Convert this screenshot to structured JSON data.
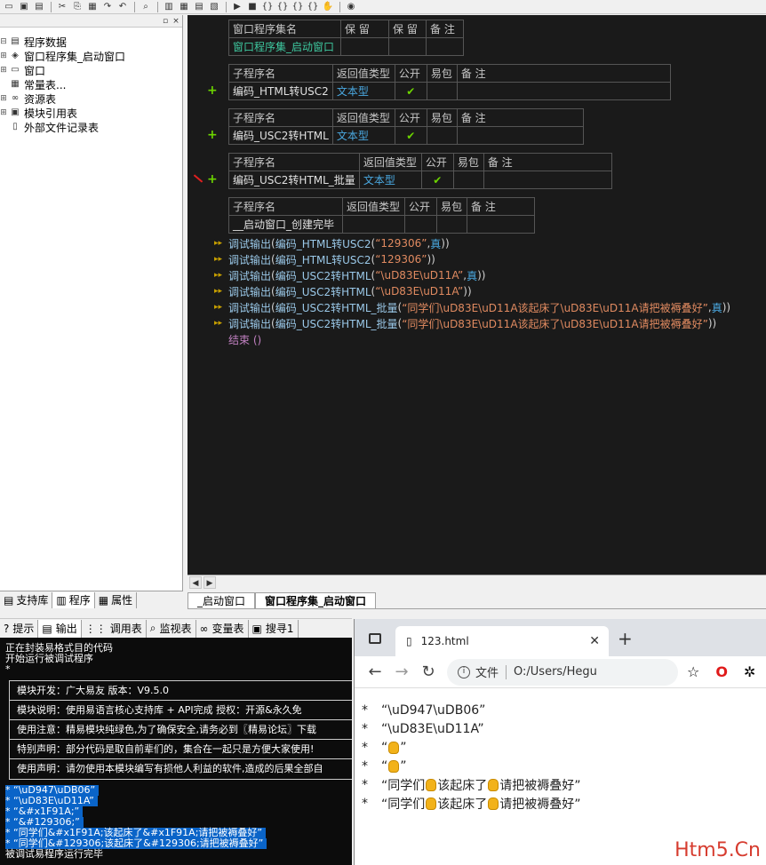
{
  "tree": {
    "items": [
      {
        "label": "程序数据",
        "icon": "folder-icon"
      },
      {
        "label": "窗口程序集_启动窗口",
        "icon": "class-icon"
      },
      {
        "label": "窗口",
        "icon": "window-icon"
      },
      {
        "label": "常量表...",
        "icon": "const-icon"
      },
      {
        "label": "资源表",
        "icon": "resource-icon"
      },
      {
        "label": "模块引用表",
        "icon": "module-icon"
      },
      {
        "label": "外部文件记录表",
        "icon": "file-icon"
      }
    ]
  },
  "left_tabs": [
    "支持库",
    "程序",
    "属性"
  ],
  "editor": {
    "class_table": {
      "headers": [
        "窗口程序集名",
        "保 留",
        "保 留",
        "备 注"
      ],
      "name": "窗口程序集_启动窗口"
    },
    "subs": [
      {
        "header_name": "子程序名",
        "header_ret": "返回值类型",
        "header_pub": "公开",
        "header_easy": "易包",
        "header_note": "备 注",
        "name": "编码_HTML转USC2",
        "ret": "文本型",
        "check": "✔"
      },
      {
        "header_name": "子程序名",
        "header_ret": "返回值类型",
        "header_pub": "公开",
        "header_easy": "易包",
        "header_note": "备 注",
        "name": "编码_USC2转HTML",
        "ret": "文本型",
        "check": "✔"
      },
      {
        "header_name": "子程序名",
        "header_ret": "返回值类型",
        "header_pub": "公开",
        "header_easy": "易包",
        "header_note": "备 注",
        "name": "编码_USC2转HTML_批量",
        "ret": "文本型",
        "check": "✔"
      },
      {
        "header_name": "子程序名",
        "header_ret": "返回值类型",
        "header_pub": "公开",
        "header_easy": "易包",
        "header_note": "备 注",
        "name": "__启动窗口_创建完毕",
        "ret": "",
        "check": ""
      }
    ],
    "lines": [
      {
        "fn": "调试输出",
        "inner": "编码_HTML转USC2",
        "arg": "“129306”",
        "flag": "真"
      },
      {
        "fn": "调试输出",
        "inner": "编码_HTML转USC2",
        "arg": "“129306”",
        "flag": ""
      },
      {
        "fn": "调试输出",
        "inner": "编码_USC2转HTML",
        "arg": "“\\uD83E\\uD11A”",
        "flag": "真"
      },
      {
        "fn": "调试输出",
        "inner": "编码_USC2转HTML",
        "arg": "“\\uD83E\\uD11A”",
        "flag": ""
      },
      {
        "fn": "调试输出",
        "inner": "编码_USC2转HTML_批量",
        "arg": "“同学们\\uD83E\\uD11A该起床了\\uD83E\\uD11A请把被褥叠好”",
        "flag": "真"
      },
      {
        "fn": "调试输出",
        "inner": "编码_USC2转HTML_批量",
        "arg": "“同学们\\uD83E\\uD11A该起床了\\uD83E\\uD11A请把被褥叠好”",
        "flag": ""
      }
    ],
    "end_line": "结束 ()"
  },
  "doc_tabs": [
    "_启动窗口",
    "窗口程序集_启动窗口"
  ],
  "output_tabs": [
    "提示",
    "输出",
    "调用表",
    "监视表",
    "变量表",
    "搜寻1"
  ],
  "console": {
    "head_lines": [
      "正在封装易格式目的代码",
      "开始运行被调试程序",
      "*"
    ],
    "box_rows": [
      "模块开发：广大易友      版本：V9.5.0",
      "模块说明：使用易语言核心支持库 + API完成       授权：开源&永久免",
      "使用注意：精易模块纯绿色,为了确保安全,请务必到〖精易论坛〗下载",
      "特别声明：部分代码是取自前辈们的，集合在一起只是方便大家使用!",
      "使用声明：请勿使用本模块编写有损他人利益的软件,造成的后果全部自"
    ],
    "sel_lines": [
      "* “\\uD947\\uDB06”",
      "* “\\uD83E\\uD11A”",
      "* “&#x1F91A;”",
      "* “&#129306;”",
      "* “同学们&#x1F91A;该起床了&#x1F91A;请把被褥叠好”",
      "* “同学们&#129306;该起床了&#129306;请把被褥叠好”"
    ],
    "tail_line": "被调试易程序运行完毕"
  },
  "browser": {
    "tab_title": "123.html",
    "addr_label": "文件",
    "url": "O:/Users/Hegu",
    "lines": [
      {
        "pre": "“\\uD947\\uDB06”",
        "hands": 0
      },
      {
        "pre": "“\\uD83E\\uD11A”",
        "hands": 0
      },
      {
        "pre": "“",
        "mid": "”",
        "hands": 1
      },
      {
        "pre": "“",
        "mid": "”",
        "hands": 1
      }
    ],
    "sentence": {
      "a": "“同学们",
      "b": "该起床了",
      "c": "请把被褥叠好”"
    }
  },
  "watermark": "Htm5.Cn",
  "colors": {
    "editor_bg": "#1a1a1a",
    "teal": "#3ec9a0",
    "type_blue": "#4aa8e0",
    "check_green": "#6cd400",
    "string_orange": "#e08a60",
    "selection_blue": "#0a64c8",
    "watermark_red": "#d63c2f"
  }
}
